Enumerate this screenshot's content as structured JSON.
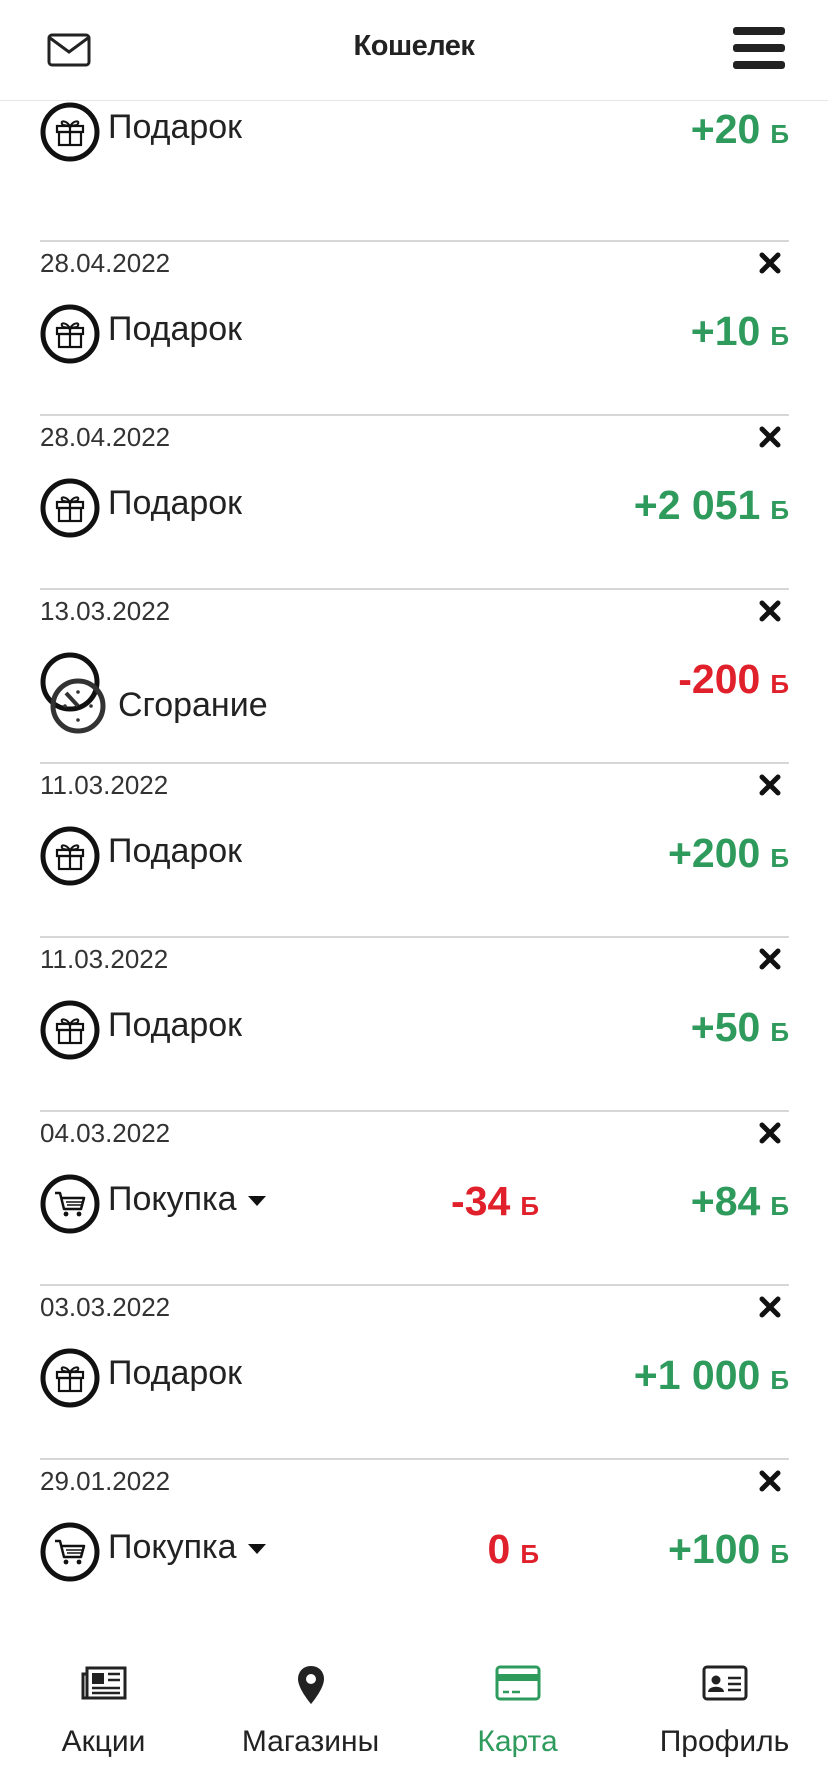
{
  "header": {
    "title": "Кошелек",
    "mail_icon": "envelope-icon",
    "menu_icon": "hamburger-menu-icon"
  },
  "transactions": [
    {
      "date": "",
      "type": "gift",
      "label": "Подарок",
      "amount": "+20",
      "unit": "Б"
    },
    {
      "date": "28.04.2022",
      "type": "gift",
      "label": "Подарок",
      "amount": "+10",
      "unit": "Б"
    },
    {
      "date": "28.04.2022",
      "type": "gift",
      "label": "Подарок",
      "amount": "+2 051",
      "unit": "Б"
    },
    {
      "date": "13.03.2022",
      "type": "burn",
      "label": "Сгорание",
      "amount": "-200",
      "unit": "Б"
    },
    {
      "date": "11.03.2022",
      "type": "gift",
      "label": "Подарок",
      "amount": "+200",
      "unit": "Б"
    },
    {
      "date": "11.03.2022",
      "type": "gift",
      "label": "Подарок",
      "amount": "+50",
      "unit": "Б"
    },
    {
      "date": "04.03.2022",
      "type": "purchase",
      "label": "Покупка",
      "spent": "-34",
      "amount": "+84",
      "unit": "Б"
    },
    {
      "date": "03.03.2022",
      "type": "gift",
      "label": "Подарок",
      "amount": "+1 000",
      "unit": "Б"
    },
    {
      "date": "29.01.2022",
      "type": "purchase",
      "label": "Покупка",
      "spent": "0",
      "amount": "+100",
      "unit": "Б"
    }
  ],
  "tabs": [
    {
      "label": "Акции",
      "icon": "newspaper-icon",
      "active": false
    },
    {
      "label": "Магазины",
      "icon": "map-pin-icon",
      "active": false
    },
    {
      "label": "Карта",
      "icon": "credit-card-icon",
      "active": true
    },
    {
      "label": "Профиль",
      "icon": "id-card-icon",
      "active": false
    }
  ],
  "colors": {
    "positive": "#2e9a5c",
    "negative": "#e0202b",
    "text": "#222222",
    "divider": "#d6d6d6"
  }
}
